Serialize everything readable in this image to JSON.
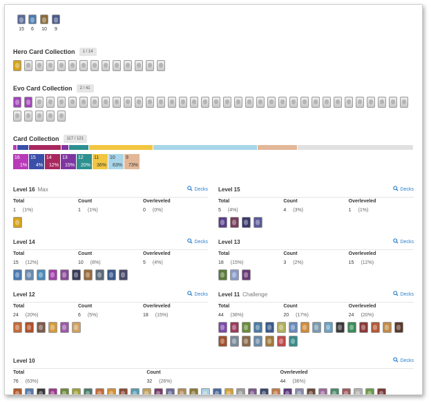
{
  "arenas": [
    {
      "icon": "arena-badge-icon",
      "value": "15",
      "color": "#5a6a9a"
    },
    {
      "icon": "arena-badge-icon",
      "value": "6",
      "color": "#4a7ab0"
    },
    {
      "icon": "arena-badge-icon",
      "value": "10",
      "color": "#8a6a3a"
    },
    {
      "icon": "arena-badge-icon",
      "value": "9",
      "color": "#4a5a8a"
    }
  ],
  "hero": {
    "title": "Hero Card Collection",
    "count": "1 / 14",
    "owned": 1,
    "total": 14,
    "owned_color": "#d4a21b"
  },
  "evo": {
    "title": "Evo Card Collection",
    "count": "2 / 41",
    "owned": 2,
    "total": 41,
    "owned_color": "#a145b8"
  },
  "collection": {
    "title": "Card Collection",
    "count": "117 / 121",
    "chips": [
      {
        "level": "16",
        "percent": "1%",
        "color": "#b83ab8"
      },
      {
        "level": "15",
        "percent": "4%",
        "color": "#3a4fa8"
      },
      {
        "level": "14",
        "percent": "12%",
        "color": "#a8285e"
      },
      {
        "level": "13",
        "percent": "15%",
        "color": "#7f35a0"
      },
      {
        "level": "12",
        "percent": "20%",
        "color": "#2e8f8f"
      },
      {
        "level": "11",
        "percent": "36%",
        "color": "#f2c641",
        "dark": true
      },
      {
        "level": "10",
        "percent": "63%",
        "color": "#a8d6e8",
        "dark": true
      },
      {
        "level": "9",
        "percent": "73%",
        "color": "#e2b899",
        "dark": true
      }
    ],
    "bar": [
      {
        "share": 0.01,
        "color": "#b83ab8"
      },
      {
        "share": 0.03,
        "color": "#3a4fa8"
      },
      {
        "share": 0.08,
        "color": "#a8285e"
      },
      {
        "share": 0.02,
        "color": "#7f35a0"
      },
      {
        "share": 0.05,
        "color": "#2e8f8f"
      },
      {
        "share": 0.16,
        "color": "#f2c641"
      },
      {
        "share": 0.26,
        "color": "#a8d6e8"
      },
      {
        "share": 0.1,
        "color": "#e2b899"
      },
      {
        "share": 0.29,
        "color": "#e1e1e1"
      }
    ]
  },
  "labels": {
    "total": "Total",
    "count": "Count",
    "overleveled": "Overleveled",
    "decks": "Decks"
  },
  "levels": [
    {
      "id": "16",
      "title": "Level 16",
      "extra": "Max",
      "total": "1",
      "total_pct": "(1%)",
      "count": "1",
      "count_pct": "(1%)",
      "over": "0",
      "over_pct": "(0%)",
      "cards": [
        "#d4a21b"
      ]
    },
    {
      "id": "15",
      "title": "Level 15",
      "extra": "",
      "total": "5",
      "total_pct": "(4%)",
      "count": "4",
      "count_pct": "(3%)",
      "over": "1",
      "over_pct": "(1%)",
      "cards": [
        "#5a3f8a",
        "#7a3d5a",
        "#3a3a6a",
        "#5a5a9a"
      ]
    },
    {
      "id": "14",
      "title": "Level 14",
      "extra": "",
      "total": "15",
      "total_pct": "(12%)",
      "count": "10",
      "count_pct": "(8%)",
      "over": "5",
      "over_pct": "(4%)",
      "cards": [
        "#4a7ab0",
        "#6a8ab0",
        "#4a8ab8",
        "#a040a8",
        "#8a4a9a",
        "#3a3a5a",
        "#9a6a3a",
        "#5a6a7a",
        "#3a5a8a",
        "#4a4a6a"
      ]
    },
    {
      "id": "13",
      "title": "Level 13",
      "extra": "",
      "total": "18",
      "total_pct": "(15%)",
      "count": "3",
      "count_pct": "(2%)",
      "over": "15",
      "over_pct": "(12%)",
      "cards": [
        "#5a7a3a",
        "#8a9ac8",
        "#6a3a7a"
      ]
    },
    {
      "id": "12",
      "title": "Level 12",
      "extra": "",
      "total": "24",
      "total_pct": "(20%)",
      "count": "6",
      "count_pct": "(5%)",
      "over": "18",
      "over_pct": "(15%)",
      "cards": [
        "#c06a3a",
        "#b0502a",
        "#7a5a4a",
        "#d49a3a",
        "#9a5aa8",
        "#d0a060"
      ]
    },
    {
      "id": "11",
      "title": "Level 11",
      "extra": "Challenge",
      "total": "44",
      "total_pct": "(36%)",
      "count": "20",
      "count_pct": "(17%)",
      "over": "24",
      "over_pct": "(20%)",
      "cards": [
        "#7a4aa8",
        "#9a3a5a",
        "#6a8a3a",
        "#4a7aa0",
        "#3a5a8a",
        "#b0b060",
        "#6a8ab8",
        "#d08a3a",
        "#7a9ab0",
        "#6aa0c0",
        "#3a3a3a",
        "#3a8a5a",
        "#8a3a3a",
        "#b05a3a",
        "#c08a4a",
        "#5a3a2a",
        "#a0502a",
        "#7a8a9a",
        "#8a6a4a",
        "#6a8aa8",
        "#a07a3a",
        "#c04a4a",
        "#3a8a8a"
      ]
    },
    {
      "id": "10",
      "title": "Level 10",
      "extra": "",
      "total": "76",
      "total_pct": "(63%)",
      "count": "32",
      "count_pct": "(26%)",
      "over": "44",
      "over_pct": "(36%)",
      "cards": [
        "#b05a2a",
        "#5a7aa8",
        "#3a3a3a",
        "#9a3a8a",
        "#6a8a3a",
        "#a0a03a",
        "#4a7a6a",
        "#c06a3a",
        "#d0903a",
        "#8a4a3a",
        "#5a9ab0",
        "#c0a060",
        "#7a3a6a",
        "#6a6a9a",
        "#b08a5a",
        "#8a7a3a",
        "#a8d0e0",
        "#4a6a9a",
        "#d0a03a",
        "#9a9a9a",
        "#7a5a8a",
        "#3a4a6a",
        "#c07a4a",
        "#5a3a7a",
        "#8a8aa8",
        "#6a4a3a",
        "#9a6a9a",
        "#4a8a6a",
        "#a05a5a",
        "#b0b0b0",
        "#6a9a4a",
        "#7a3a3a"
      ]
    }
  ]
}
